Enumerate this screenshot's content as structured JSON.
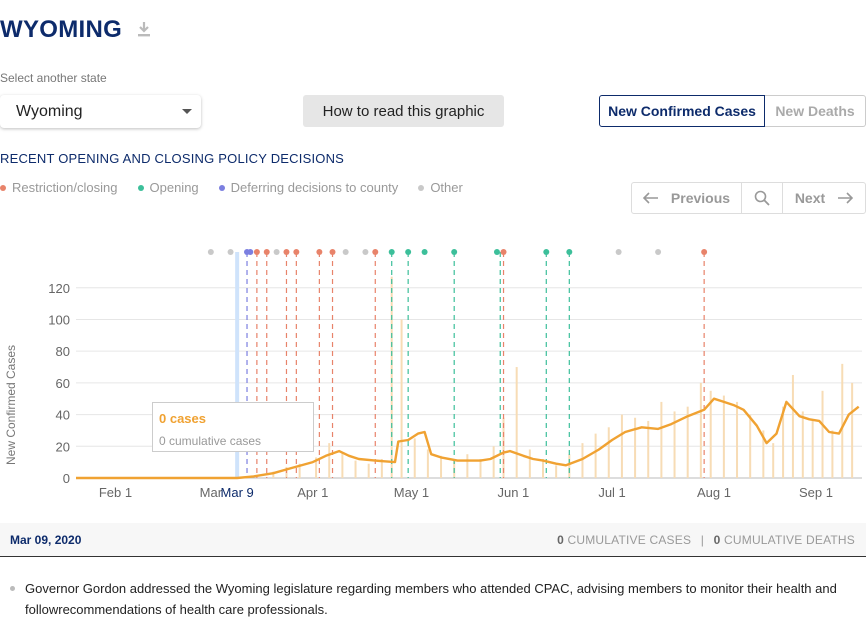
{
  "header": {
    "title": "WYOMING",
    "download_icon": "download-icon"
  },
  "state_select": {
    "label": "Select another state",
    "value": "Wyoming"
  },
  "howto_button": "How to read this graphic",
  "metric_toggle": {
    "active": "New Confirmed Cases",
    "inactive": "New Deaths"
  },
  "policy_heading": "RECENT OPENING AND CLOSING POLICY DECISIONS",
  "legend": [
    {
      "label": "Restriction/closing",
      "color": "#e8836a"
    },
    {
      "label": "Opening",
      "color": "#3cbf9a"
    },
    {
      "label": "Deferring decisions to county",
      "color": "#7b7fe0"
    },
    {
      "label": "Other",
      "color": "#c9c9c9"
    }
  ],
  "pager": {
    "previous": "Previous",
    "next": "Next",
    "search_icon": "magnifier-icon"
  },
  "tooltip": {
    "cases": "0 cases",
    "cumulative": "0 cumulative cases"
  },
  "info_bar": {
    "date": "Mar 09, 2020",
    "cum_cases_value": "0",
    "cum_cases_label": "CUMULATIVE CASES",
    "separator": "|",
    "cum_deaths_value": "0",
    "cum_deaths_label": "CUMULATIVE DEATHS"
  },
  "note": "Governor Gordon addressed the Wyoming legislature regarding members who attended CPAC, advising members to monitor their health and followrecommendations of health care professionals.",
  "chart_data": {
    "type": "line",
    "ylabel": "New Confirmed Cases",
    "yticks": [
      0,
      20,
      40,
      60,
      80,
      100,
      120
    ],
    "ylim": [
      0,
      135
    ],
    "x_start": "2020-01-20",
    "x_end": "2020-09-15",
    "xtick_labels": [
      {
        "date": "2020-02-01",
        "label": "Feb 1"
      },
      {
        "date": "2020-03-01",
        "label": "Mar"
      },
      {
        "date": "2020-04-01",
        "label": "Apr 1"
      },
      {
        "date": "2020-05-01",
        "label": "May 1"
      },
      {
        "date": "2020-06-01",
        "label": "Jun 1"
      },
      {
        "date": "2020-07-01",
        "label": "Jul 1"
      },
      {
        "date": "2020-08-01",
        "label": "Aug 1"
      },
      {
        "date": "2020-09-01",
        "label": "Sep 1"
      }
    ],
    "selected_date": {
      "date": "2020-03-09",
      "label": "Mar 9"
    },
    "grid": true,
    "series": [
      {
        "kind": "moving-average-line",
        "color": "#f0a232",
        "points": [
          [
            "2020-01-20",
            0
          ],
          [
            "2020-03-09",
            0
          ],
          [
            "2020-03-14",
            1
          ],
          [
            "2020-03-20",
            3
          ],
          [
            "2020-03-25",
            6
          ],
          [
            "2020-04-01",
            10
          ],
          [
            "2020-04-05",
            14
          ],
          [
            "2020-04-09",
            17
          ],
          [
            "2020-04-12",
            14
          ],
          [
            "2020-04-15",
            12
          ],
          [
            "2020-04-20",
            11
          ],
          [
            "2020-04-26",
            10
          ],
          [
            "2020-04-27",
            23
          ],
          [
            "2020-04-30",
            24
          ],
          [
            "2020-05-03",
            28
          ],
          [
            "2020-05-05",
            29
          ],
          [
            "2020-05-07",
            15
          ],
          [
            "2020-05-10",
            13
          ],
          [
            "2020-05-15",
            11
          ],
          [
            "2020-05-22",
            11
          ],
          [
            "2020-05-25",
            12
          ],
          [
            "2020-05-29",
            16
          ],
          [
            "2020-05-31",
            17
          ],
          [
            "2020-06-04",
            14
          ],
          [
            "2020-06-07",
            12
          ],
          [
            "2020-06-10",
            11
          ],
          [
            "2020-06-14",
            9
          ],
          [
            "2020-06-17",
            8
          ],
          [
            "2020-06-22",
            12
          ],
          [
            "2020-06-27",
            18
          ],
          [
            "2020-07-01",
            24
          ],
          [
            "2020-07-05",
            29
          ],
          [
            "2020-07-10",
            32
          ],
          [
            "2020-07-15",
            31
          ],
          [
            "2020-07-19",
            34
          ],
          [
            "2020-07-24",
            39
          ],
          [
            "2020-07-29",
            43
          ],
          [
            "2020-08-01",
            50
          ],
          [
            "2020-08-04",
            48
          ],
          [
            "2020-08-07",
            46
          ],
          [
            "2020-08-10",
            43
          ],
          [
            "2020-08-14",
            33
          ],
          [
            "2020-08-17",
            22
          ],
          [
            "2020-08-20",
            28
          ],
          [
            "2020-08-23",
            48
          ],
          [
            "2020-08-27",
            39
          ],
          [
            "2020-08-30",
            37
          ],
          [
            "2020-09-02",
            36
          ],
          [
            "2020-09-05",
            29
          ],
          [
            "2020-09-08",
            28
          ],
          [
            "2020-09-11",
            40
          ],
          [
            "2020-09-14",
            45
          ]
        ]
      },
      {
        "kind": "daily-bars",
        "color": "#f7dcb5",
        "points": [
          [
            "2020-03-20",
            4
          ],
          [
            "2020-03-24",
            7
          ],
          [
            "2020-03-28",
            9
          ],
          [
            "2020-04-02",
            13
          ],
          [
            "2020-04-06",
            22
          ],
          [
            "2020-04-10",
            16
          ],
          [
            "2020-04-14",
            11
          ],
          [
            "2020-04-18",
            9
          ],
          [
            "2020-04-22",
            12
          ],
          [
            "2020-04-25",
            127
          ],
          [
            "2020-04-28",
            100
          ],
          [
            "2020-05-02",
            25
          ],
          [
            "2020-05-06",
            18
          ],
          [
            "2020-05-10",
            14
          ],
          [
            "2020-05-14",
            12
          ],
          [
            "2020-05-18",
            15
          ],
          [
            "2020-05-22",
            12
          ],
          [
            "2020-05-26",
            20
          ],
          [
            "2020-05-29",
            38
          ],
          [
            "2020-06-02",
            70
          ],
          [
            "2020-06-06",
            18
          ],
          [
            "2020-06-10",
            12
          ],
          [
            "2020-06-14",
            8
          ],
          [
            "2020-06-18",
            15
          ],
          [
            "2020-06-22",
            22
          ],
          [
            "2020-06-26",
            28
          ],
          [
            "2020-06-30",
            32
          ],
          [
            "2020-07-04",
            40
          ],
          [
            "2020-07-08",
            38
          ],
          [
            "2020-07-12",
            36
          ],
          [
            "2020-07-16",
            48
          ],
          [
            "2020-07-20",
            42
          ],
          [
            "2020-07-24",
            45
          ],
          [
            "2020-07-28",
            60
          ],
          [
            "2020-07-31",
            55
          ],
          [
            "2020-08-04",
            52
          ],
          [
            "2020-08-08",
            48
          ],
          [
            "2020-08-12",
            40
          ],
          [
            "2020-08-16",
            30
          ],
          [
            "2020-08-19",
            22
          ],
          [
            "2020-08-22",
            45
          ],
          [
            "2020-08-25",
            65
          ],
          [
            "2020-08-28",
            42
          ],
          [
            "2020-08-31",
            36
          ],
          [
            "2020-09-03",
            55
          ],
          [
            "2020-09-06",
            30
          ],
          [
            "2020-09-09",
            72
          ],
          [
            "2020-09-12",
            60
          ]
        ]
      }
    ],
    "policy_events": [
      {
        "date": "2020-03-12",
        "type": "deferring"
      },
      {
        "date": "2020-03-15",
        "type": "restriction"
      },
      {
        "date": "2020-03-18",
        "type": "restriction"
      },
      {
        "date": "2020-03-24",
        "type": "restriction"
      },
      {
        "date": "2020-03-27",
        "type": "restriction"
      },
      {
        "date": "2020-04-03",
        "type": "restriction"
      },
      {
        "date": "2020-04-07",
        "type": "restriction"
      },
      {
        "date": "2020-04-20",
        "type": "restriction"
      },
      {
        "date": "2020-04-25",
        "type": "opening"
      },
      {
        "date": "2020-04-30",
        "type": "opening"
      },
      {
        "date": "2020-05-14",
        "type": "opening"
      },
      {
        "date": "2020-05-28",
        "type": "opening"
      },
      {
        "date": "2020-05-29",
        "type": "restriction"
      },
      {
        "date": "2020-06-11",
        "type": "opening"
      },
      {
        "date": "2020-06-18",
        "type": "opening"
      },
      {
        "date": "2020-07-29",
        "type": "restriction"
      }
    ],
    "policy_dots": [
      {
        "date": "2020-03-01",
        "type": "other"
      },
      {
        "date": "2020-03-07",
        "type": "other"
      },
      {
        "date": "2020-03-12",
        "type": "deferring"
      },
      {
        "date": "2020-03-13",
        "type": "deferring"
      },
      {
        "date": "2020-03-15",
        "type": "restriction"
      },
      {
        "date": "2020-03-18",
        "type": "restriction"
      },
      {
        "date": "2020-03-21",
        "type": "other"
      },
      {
        "date": "2020-03-24",
        "type": "restriction"
      },
      {
        "date": "2020-03-27",
        "type": "restriction"
      },
      {
        "date": "2020-04-03",
        "type": "restriction"
      },
      {
        "date": "2020-04-07",
        "type": "restriction"
      },
      {
        "date": "2020-04-11",
        "type": "other"
      },
      {
        "date": "2020-04-17",
        "type": "other"
      },
      {
        "date": "2020-04-20",
        "type": "restriction"
      },
      {
        "date": "2020-04-25",
        "type": "opening"
      },
      {
        "date": "2020-04-30",
        "type": "opening"
      },
      {
        "date": "2020-05-05",
        "type": "opening"
      },
      {
        "date": "2020-05-14",
        "type": "opening"
      },
      {
        "date": "2020-05-27",
        "type": "opening"
      },
      {
        "date": "2020-05-29",
        "type": "restriction"
      },
      {
        "date": "2020-06-11",
        "type": "opening"
      },
      {
        "date": "2020-06-18",
        "type": "opening"
      },
      {
        "date": "2020-07-03",
        "type": "other"
      },
      {
        "date": "2020-07-15",
        "type": "other"
      },
      {
        "date": "2020-07-29",
        "type": "restriction"
      }
    ]
  }
}
